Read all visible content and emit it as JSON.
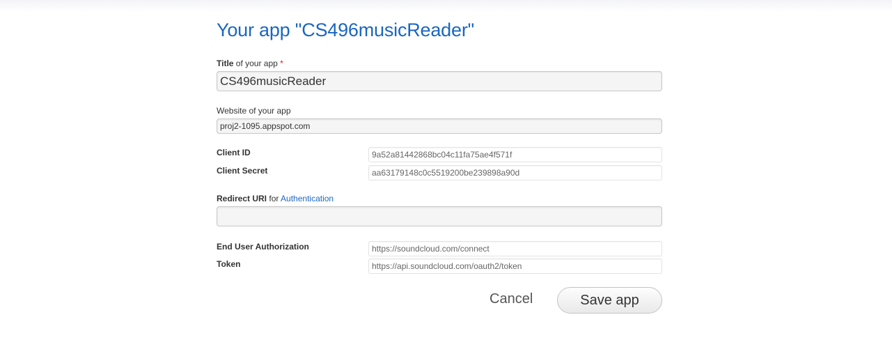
{
  "page_title": "Your app \"CS496musicReader\"",
  "fields": {
    "title": {
      "label_bold": "Title",
      "label_rest": " of your app ",
      "required_mark": "*",
      "value": "CS496musicReader"
    },
    "website": {
      "label": "Website of your app",
      "value": "proj2-1095.appspot.com"
    },
    "client_id": {
      "label": "Client ID",
      "value": "9a52a81442868bc04c11fa75ae4f571f"
    },
    "client_secret": {
      "label": "Client Secret",
      "value": "aa63179148c0c5519200be239898a90d"
    },
    "redirect_uri": {
      "label_bold": "Redirect URI",
      "label_rest": " for ",
      "label_link": "Authentication",
      "value": ""
    },
    "end_user_authorization": {
      "label": "End User Authorization",
      "value": "https://soundcloud.com/connect"
    },
    "token": {
      "label": "Token",
      "value": "https://api.soundcloud.com/oauth2/token"
    }
  },
  "actions": {
    "cancel_label": "Cancel",
    "save_label": "Save app"
  },
  "colors": {
    "title": "#1a67c0",
    "link": "#1a67c0",
    "required": "#e02020"
  }
}
